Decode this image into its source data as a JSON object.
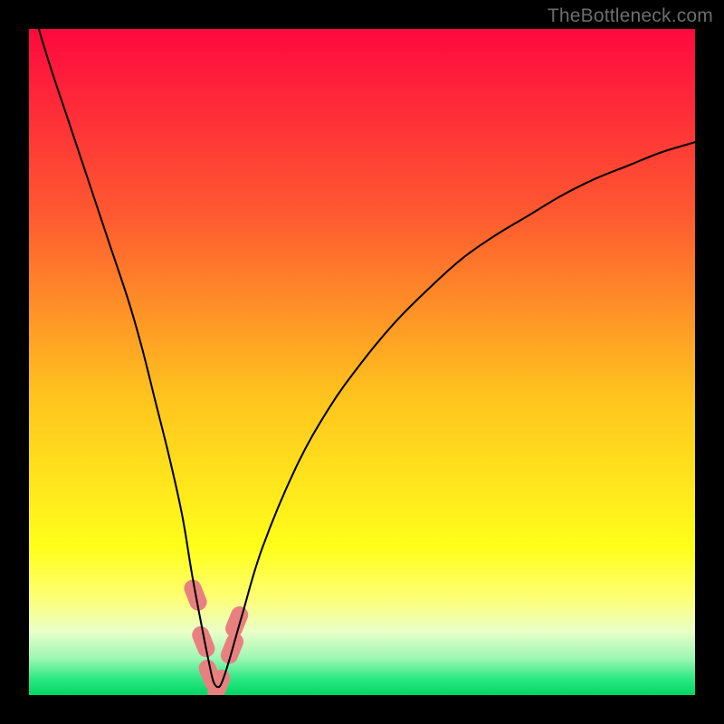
{
  "watermark": "TheBottleneck.com",
  "colors": {
    "black": "#000000",
    "curve": "#000000",
    "marker": "#e98080",
    "gradient_top": "#fe093e",
    "gradient_mid1": "#fe6d2d",
    "gradient_mid2": "#ffd21c",
    "gradient_yellow": "#ffff1a",
    "gradient_pale": "#f3ffb0",
    "gradient_green": "#00e46a",
    "watermark_gray": "#6d6d6d"
  },
  "chart_data": {
    "type": "line",
    "title": "",
    "xlabel": "",
    "ylabel": "",
    "xlim": [
      0,
      100
    ],
    "ylim": [
      0,
      100
    ],
    "grid": false,
    "series": [
      {
        "name": "bottleneck-curve",
        "x": [
          0,
          3,
          6,
          9,
          12,
          15,
          17,
          19,
          21,
          23,
          24.5,
          26,
          27,
          27.7,
          28.4,
          29,
          30,
          32,
          35,
          40,
          45,
          50,
          55,
          60,
          65,
          70,
          75,
          80,
          85,
          90,
          95,
          100
        ],
        "y": [
          105,
          95,
          86,
          77,
          68,
          59,
          52,
          44,
          36,
          27,
          18,
          10,
          5,
          2,
          1.2,
          2,
          5,
          12,
          22,
          34,
          43,
          50,
          56,
          61,
          65.5,
          69,
          72,
          75,
          77.5,
          79.5,
          81.5,
          83
        ]
      }
    ],
    "markers": [
      {
        "x": 25.0,
        "y": 15
      },
      {
        "x": 26.2,
        "y": 8
      },
      {
        "x": 27.2,
        "y": 3
      },
      {
        "x": 28.5,
        "y": 1.5
      },
      {
        "x": 30.5,
        "y": 7
      },
      {
        "x": 31.2,
        "y": 11
      }
    ],
    "gradient_stops": [
      {
        "offset": 0.0,
        "color": "#fe093e"
      },
      {
        "offset": 0.28,
        "color": "#fe5a30"
      },
      {
        "offset": 0.55,
        "color": "#ffc31e"
      },
      {
        "offset": 0.78,
        "color": "#ffff1a"
      },
      {
        "offset": 0.85,
        "color": "#ffff70"
      },
      {
        "offset": 0.905,
        "color": "#e9ffc8"
      },
      {
        "offset": 0.945,
        "color": "#9cf7b3"
      },
      {
        "offset": 0.975,
        "color": "#2fe985"
      },
      {
        "offset": 1.0,
        "color": "#00d763"
      }
    ]
  }
}
